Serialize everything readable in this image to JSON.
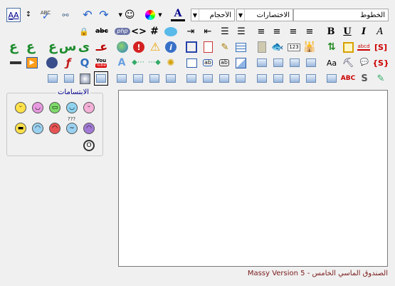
{
  "toolbar": {
    "font_select": "الخطوط",
    "shortcuts_select": "الاختصارات",
    "sizes_select": "الأحجام",
    "spellcheck_label": "ABC",
    "php_label": "php",
    "code_label": "<>",
    "hash_label": "#",
    "info_label": "i",
    "bold_label": "B",
    "underline_label": "U",
    "italic_label": "I",
    "font_color_label": "A",
    "strike_label": "abc",
    "number_label": "123",
    "abcd_label": "abcd",
    "youtube_label": "You",
    "abc_red_label": "ABC",
    "ab_label": "ab",
    "aa_label": "Aa",
    "s_label": "S"
  },
  "smileys": {
    "title": "الابتسامات"
  },
  "editor": {
    "content": ""
  },
  "status": {
    "footer_text": "الصندوق الماسي الخامس - Massy Version 5"
  },
  "colors": {
    "accent": "#00008b",
    "footer_text": "#7a1a1a"
  }
}
